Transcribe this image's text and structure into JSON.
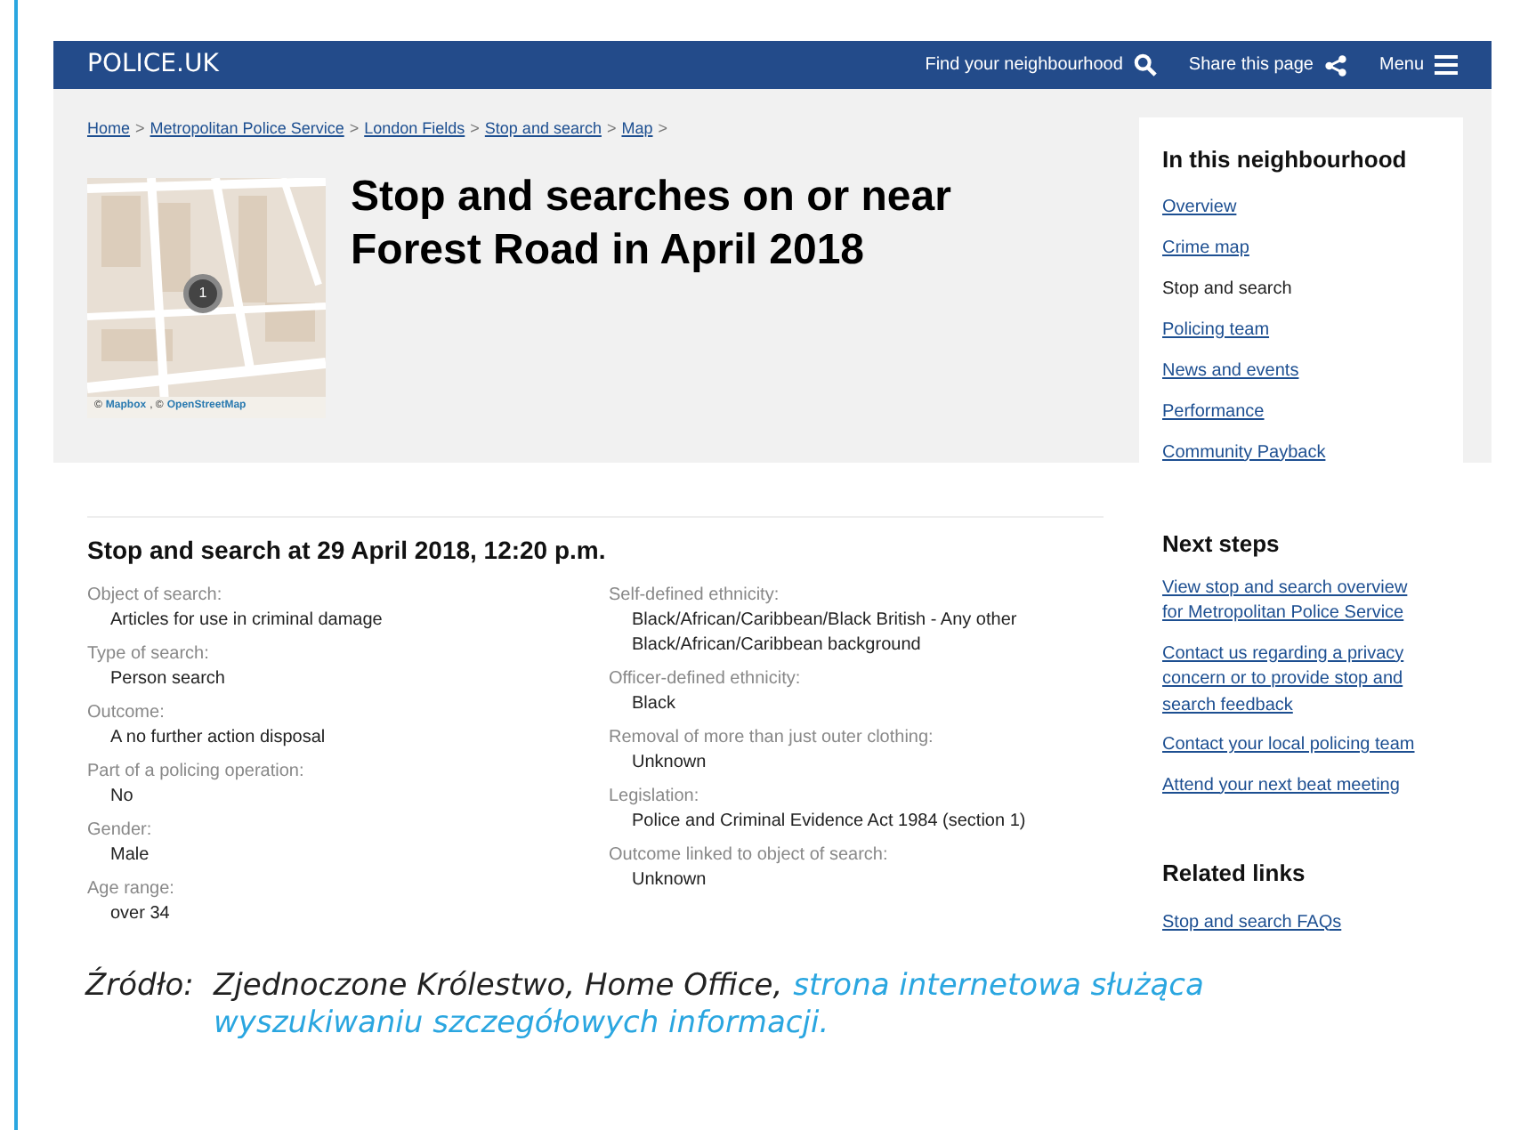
{
  "header": {
    "logo": "POLICE.UK",
    "actions": [
      {
        "label": "Find your neighbourhood",
        "kind": "search"
      },
      {
        "label": "Share this page",
        "kind": "share"
      },
      {
        "label": "Menu",
        "kind": "menu"
      }
    ]
  },
  "breadcrumbs": [
    "Home",
    "Metropolitan Police Service",
    "London Fields",
    "Stop and search",
    "Map"
  ],
  "breadcrumb_separator": ">",
  "map": {
    "marker": "1",
    "attribution": [
      {
        "text": "©",
        "kind": "text"
      },
      {
        "text": "Mapbox",
        "kind": "link"
      },
      {
        "text": ", ©",
        "kind": "text"
      },
      {
        "text": "OpenStreetMap",
        "kind": "link"
      }
    ]
  },
  "title": "Stop and searches on or near Forest Road in April 2018",
  "record": {
    "heading": "Stop and search at 29 April 2018, 12:20 p.m.",
    "columns": [
      [
        {
          "label": "Object of search:",
          "value": "Articles for use in criminal damage"
        },
        {
          "label": "Type of search:",
          "value": "Person search"
        },
        {
          "label": "Outcome:",
          "value": "A no further action disposal"
        },
        {
          "label": "Part of a policing operation:",
          "value": "No"
        },
        {
          "label": "Gender:",
          "value": "Male"
        },
        {
          "label": "Age range:",
          "value": "over 34"
        }
      ],
      [
        {
          "label": "Self-defined ethnicity:",
          "value": "Black/African/Caribbean/Black British - Any other Black/African/Caribbean background"
        },
        {
          "label": "Officer-defined ethnicity:",
          "value": "Black"
        },
        {
          "label": "Removal of more than just outer clothing:",
          "value": "Unknown"
        },
        {
          "label": "Legislation:",
          "value": "Police and Criminal Evidence Act 1984 (section 1)"
        },
        {
          "label": "Outcome linked to object of search:",
          "value": "Unknown"
        }
      ]
    ]
  },
  "sidebar": {
    "heading": "In this neighbourhood",
    "items": [
      {
        "label": "Overview",
        "selected": false
      },
      {
        "label": "Crime map",
        "selected": false
      },
      {
        "label": "Stop and search",
        "selected": true
      },
      {
        "label": "Policing team",
        "selected": false
      },
      {
        "label": "News and events",
        "selected": false
      },
      {
        "label": "Performance",
        "selected": false
      },
      {
        "label": "Community Payback",
        "selected": false
      }
    ]
  },
  "next_steps": {
    "heading": "Next steps",
    "links": [
      "View stop and search overview for Metropolitan Police Service",
      "Contact us regarding a privacy concern or to provide stop and search feedback",
      "Contact your local policing team",
      "Attend your next beat meeting"
    ]
  },
  "related_links": {
    "heading": "Related links",
    "links": [
      "Stop and search FAQs"
    ]
  },
  "caption": {
    "label": "Źródło:",
    "text": "Zjednoczone Królestwo, Home Office,",
    "link_lines": [
      "strona internetowa służąca",
      "wyszukiwaniu szczegółowych informacji."
    ]
  }
}
